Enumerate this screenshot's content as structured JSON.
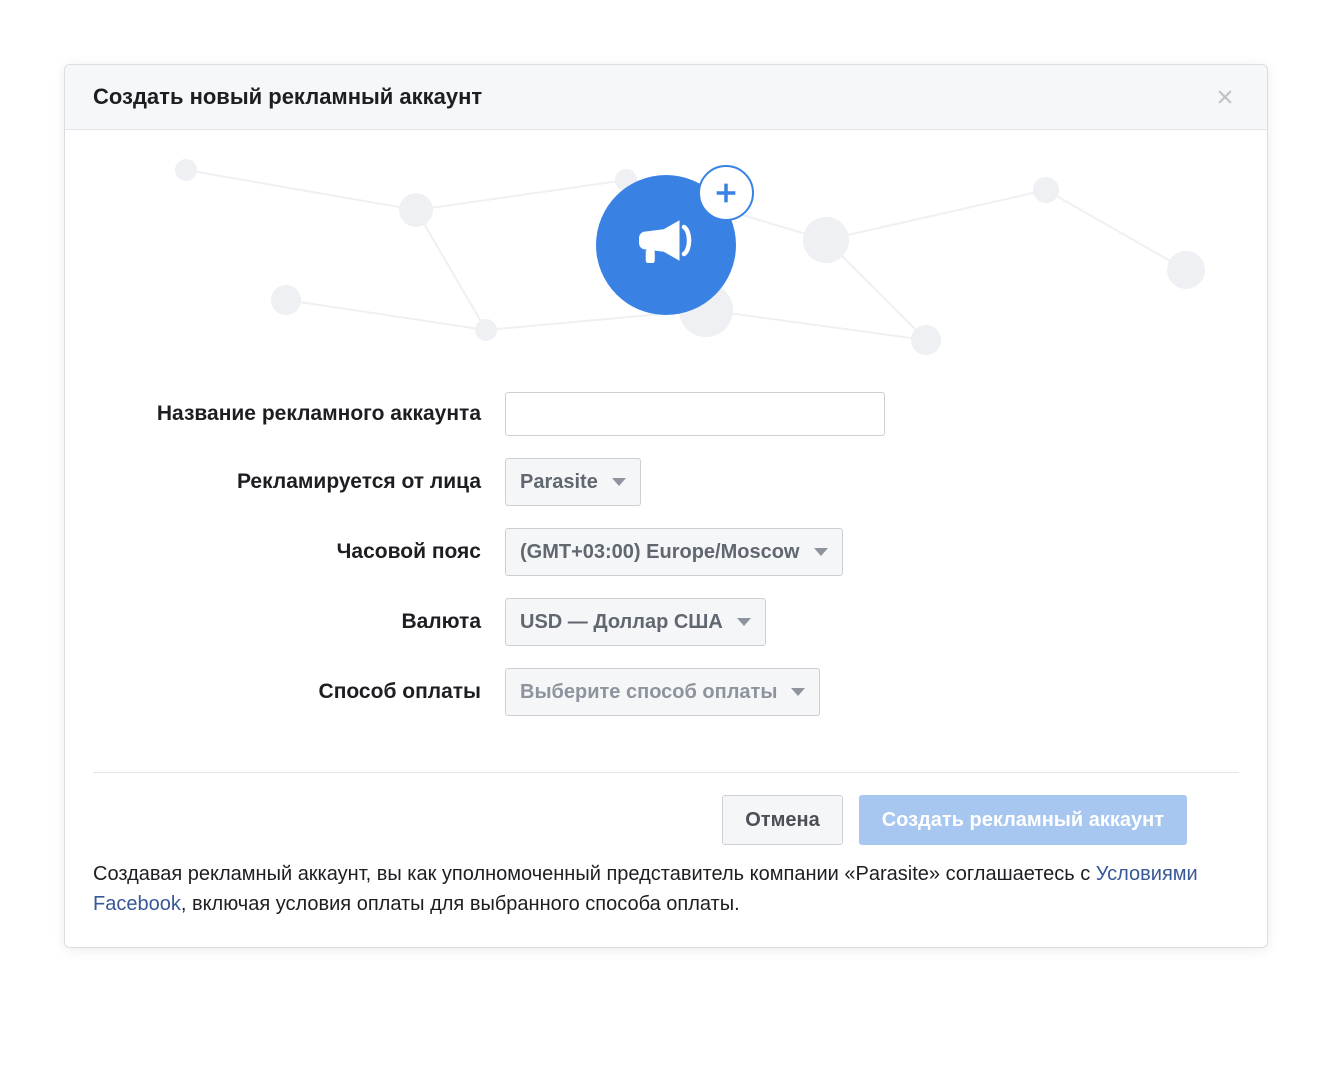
{
  "modal": {
    "title": "Создать новый рекламный аккаунт"
  },
  "form": {
    "account_name": {
      "label": "Название рекламного аккаунта",
      "value": ""
    },
    "on_behalf": {
      "label": "Рекламируется от лица",
      "value": "Parasite"
    },
    "timezone": {
      "label": "Часовой пояс",
      "value": "(GMT+03:00) Europe/Moscow"
    },
    "currency": {
      "label": "Валюта",
      "value": "USD — Доллар США"
    },
    "payment": {
      "label": "Способ оплаты",
      "placeholder": "Выберите способ оплаты"
    }
  },
  "actions": {
    "cancel": "Отмена",
    "submit": "Создать рекламный аккаунт"
  },
  "disclaimer": {
    "pre": "Создавая рекламный аккаунт, вы как уполномоченный представитель компании «Parasite» соглашаетесь с ",
    "link": "Условиями Facebook",
    "post": ", включая условия оплаты для выбранного способа оплаты."
  },
  "colors": {
    "accent": "#3982e4",
    "link": "#385898"
  }
}
